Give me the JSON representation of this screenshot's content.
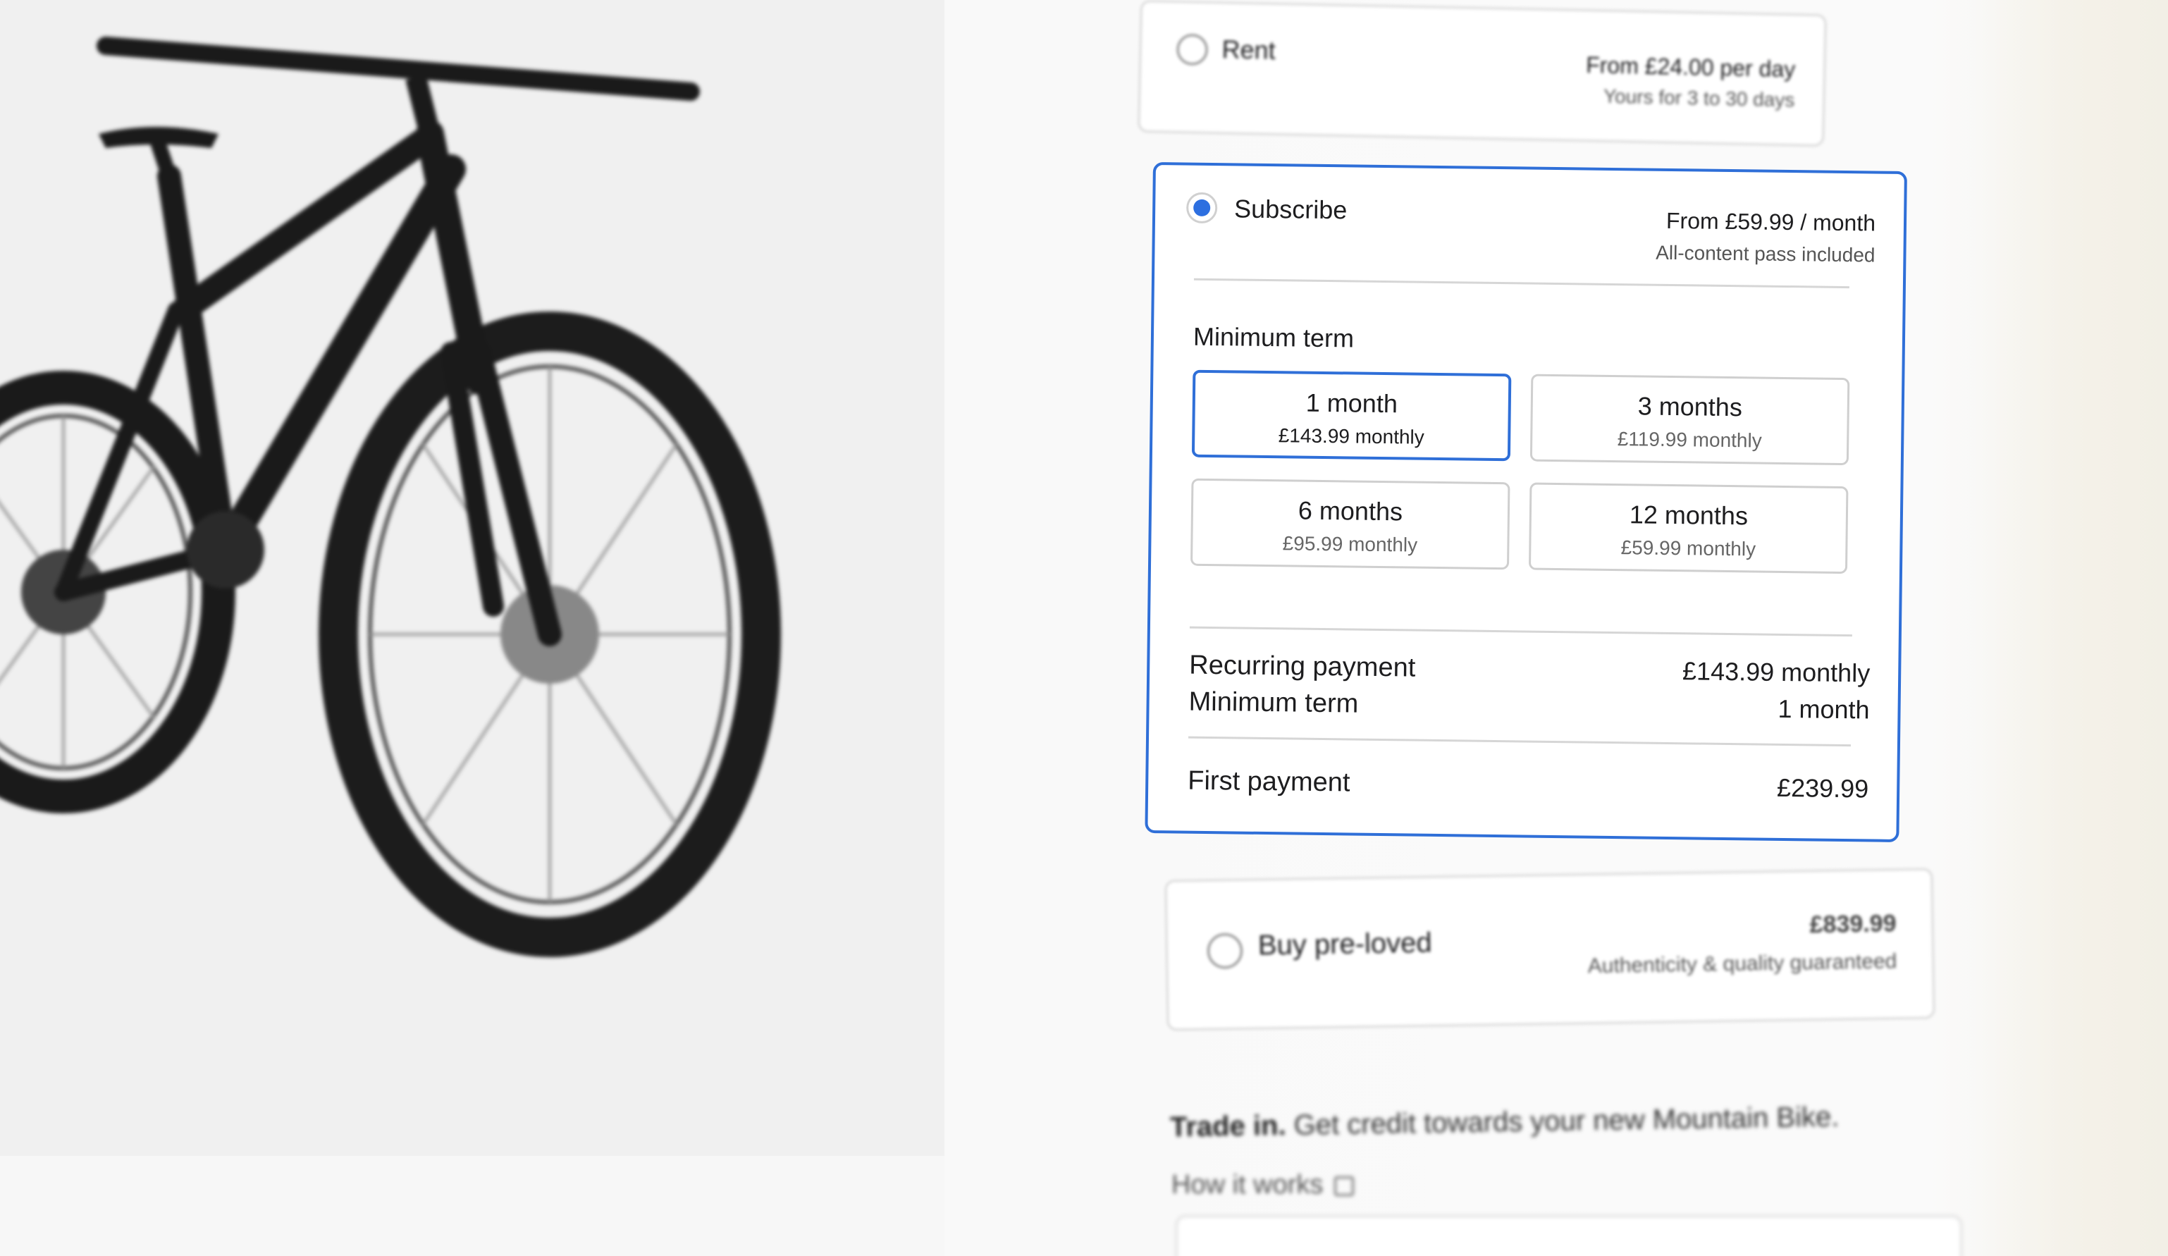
{
  "options": {
    "rent": {
      "label": "Rent",
      "price": "From £24.00 per day",
      "sub": "Yours for 3 to 30 days"
    },
    "subscribe": {
      "label": "Subscribe",
      "price": "From £59.99 / month",
      "sub": "All-content pass included",
      "minimum_term_title": "Minimum term",
      "terms": [
        {
          "name": "1 month",
          "price": "£143.99 monthly",
          "selected": true
        },
        {
          "name": "3 months",
          "price": "£119.99 monthly",
          "selected": false
        },
        {
          "name": "6 months",
          "price": "£95.99 monthly",
          "selected": false
        },
        {
          "name": "12 months",
          "price": "£59.99 monthly",
          "selected": false
        }
      ],
      "summary": {
        "recurring_label": "Recurring payment",
        "recurring_value": "£143.99 monthly",
        "min_term_label": "Minimum term",
        "min_term_value": "1 month",
        "first_label": "First payment",
        "first_value": "£239.99"
      }
    },
    "preloved": {
      "label": "Buy pre-loved",
      "price": "£839.99",
      "sub": "Authenticity & quality guaranteed"
    }
  },
  "trade_in": {
    "bold": "Trade in.",
    "text": "Get credit towards your new Mountain Bike.",
    "link": "How it works"
  },
  "colors": {
    "accent": "#2f6fd8",
    "radio_selected": "#2d6fe0"
  },
  "icons": {
    "external_link": "external-link-icon"
  }
}
